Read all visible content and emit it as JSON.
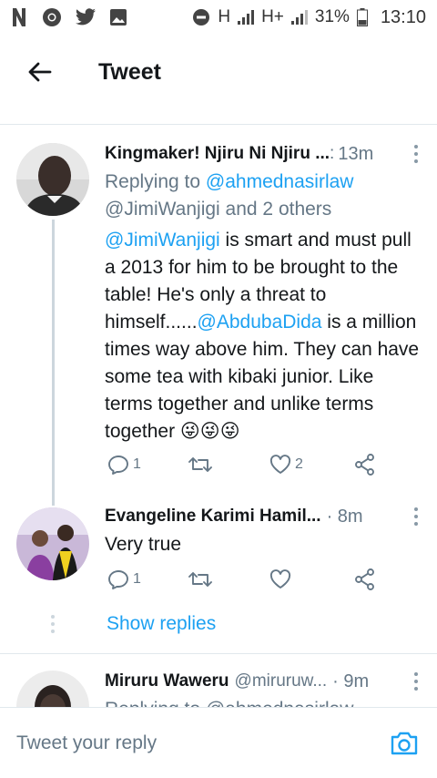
{
  "status_bar": {
    "left_icons": [
      "netflix-icon",
      "chrome-icon",
      "twitter-icon",
      "gallery-icon"
    ],
    "right_icons": [
      "dnd-icon",
      "signal-h-icon",
      "signal-hplus-icon"
    ],
    "network_1": "H",
    "network_2": "H+",
    "battery_percent": "31%",
    "time": "13:10"
  },
  "header": {
    "title": "Tweet"
  },
  "tweets": [
    {
      "name": "Kingmaker! Njiru Ni Njiru ...",
      "handle": ":",
      "time": "13m",
      "replying_prefix": "Replying to",
      "replying_to": "@ahmednasirlaw",
      "replying_more": "@JimiWanjigi and 2 others",
      "text_parts": [
        "@JimiWanjigi",
        " is smart and must pull a 2013 for him to be brought to the table! He's only a threat to himself......",
        "@AbdubaDida",
        " is a million times way above him. They can have some tea with kibaki junior. Like terms together and unlike terms together ",
        "😜😜😜"
      ],
      "reply_count": "1",
      "retweet_count": "",
      "like_count": "2"
    },
    {
      "name": "Evangeline Karimi Hamil...",
      "time": "· 8m",
      "text": "Very true",
      "reply_count": "1",
      "retweet_count": "",
      "like_count": ""
    },
    {
      "name": "Miruru Waweru",
      "handle": "@miruruw...",
      "time": "· 9m",
      "replying_partial": "Replying to @ahmednasirlaw"
    }
  ],
  "show_replies": "Show replies",
  "reply_bar": {
    "placeholder": "Tweet your reply"
  },
  "colors": {
    "accent": "#1da1f2",
    "text": "#14171a",
    "secondary": "#657786",
    "divider": "#e1e8ed"
  }
}
